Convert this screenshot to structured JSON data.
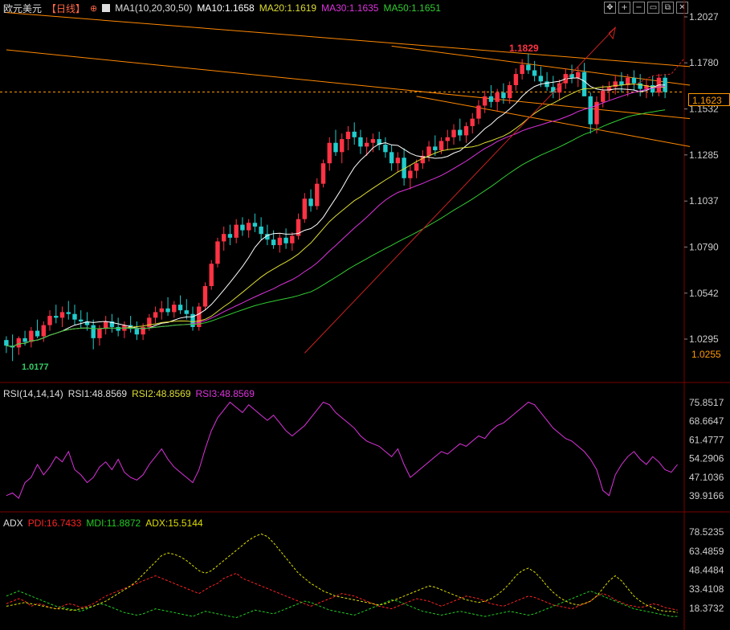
{
  "header": {
    "symbol": "欧元美元",
    "period": "【日线】",
    "ma_group": "MA1(10,20,30,50)",
    "ma10": "MA10:1.1658",
    "ma20": "MA20:1.1619",
    "ma30": "MA30:1.1635",
    "ma50": "MA50:1.1651"
  },
  "toolbar_icons": [
    "move-icon",
    "zoom-in-icon",
    "zoom-out-icon",
    "window-icon",
    "restore-icon",
    "close-icon"
  ],
  "toolbar_glyphs": [
    "✥",
    "+",
    "−",
    "▭",
    "⧉",
    "✕"
  ],
  "price_axis": {
    "ticks": [
      "1.2027",
      "1.1780",
      "1.1532",
      "1.1285",
      "1.1037",
      "1.0790",
      "1.0542",
      "1.0295"
    ],
    "current_price": "1.1623",
    "low_price_tag": "1.0255"
  },
  "annotations": {
    "high": "1.1829",
    "low": "1.0177"
  },
  "rsi_panel": {
    "title": "RSI(14,14,14)",
    "rsi1": "RSI1:48.8569",
    "rsi2": "RSI2:48.8569",
    "rsi3": "RSI3:48.8569",
    "ticks": [
      "75.8517",
      "68.6647",
      "61.4777",
      "54.2906",
      "47.1036",
      "39.9166"
    ]
  },
  "adx_panel": {
    "title": "ADX",
    "pdi": "PDI:16.7433",
    "mdi": "MDI:11.8872",
    "adx": "ADX:15.5144",
    "ticks": [
      "78.5235",
      "63.4859",
      "48.4484",
      "33.4108",
      "18.3732"
    ]
  },
  "colors": {
    "up": "#ff3344",
    "down": "#22cccc",
    "ma10": "#ffffff",
    "ma20": "#dddd33",
    "ma30": "#dd33dd",
    "ma50": "#33cc33",
    "channel": "#ff8800",
    "rsi": "#dd33dd",
    "pdi": "#ff2222",
    "mdi": "#22cc22",
    "adx": "#dddd00",
    "axis_text": "#cccccc"
  },
  "chart_data": [
    {
      "type": "candlestick",
      "title": "欧元美元【日线】",
      "ylim": [
        1.0177,
        1.2027
      ],
      "high": 1.1829,
      "low": 1.0177,
      "last": 1.1623,
      "series": [
        {
          "name": "MA10",
          "last": 1.1658
        },
        {
          "name": "MA20",
          "last": 1.1619
        },
        {
          "name": "MA30",
          "last": 1.1635
        },
        {
          "name": "MA50",
          "last": 1.1651
        }
      ],
      "candles": [
        [
          1.029,
          1.031,
          1.022,
          1.026
        ],
        [
          1.026,
          1.032,
          1.0177,
          1.025
        ],
        [
          1.025,
          1.031,
          1.021,
          1.03
        ],
        [
          1.03,
          1.034,
          1.026,
          1.028
        ],
        [
          1.028,
          1.036,
          1.025,
          1.034
        ],
        [
          1.034,
          1.04,
          1.03,
          1.031
        ],
        [
          1.031,
          1.039,
          1.028,
          1.037
        ],
        [
          1.037,
          1.045,
          1.034,
          1.042
        ],
        [
          1.042,
          1.048,
          1.038,
          1.041
        ],
        [
          1.041,
          1.047,
          1.036,
          1.044
        ],
        [
          1.044,
          1.05,
          1.04,
          1.043
        ],
        [
          1.043,
          1.048,
          1.037,
          1.04
        ],
        [
          1.04,
          1.045,
          1.035,
          1.039
        ],
        [
          1.039,
          1.044,
          1.034,
          1.037
        ],
        [
          1.037,
          1.04,
          1.024,
          1.03
        ],
        [
          1.03,
          1.037,
          1.026,
          1.035
        ],
        [
          1.035,
          1.042,
          1.032,
          1.039
        ],
        [
          1.039,
          1.043,
          1.033,
          1.036
        ],
        [
          1.036,
          1.041,
          1.031,
          1.034
        ],
        [
          1.034,
          1.039,
          1.03,
          1.037
        ],
        [
          1.037,
          1.042,
          1.033,
          1.035
        ],
        [
          1.035,
          1.039,
          1.029,
          1.032
        ],
        [
          1.032,
          1.038,
          1.029,
          1.036
        ],
        [
          1.036,
          1.043,
          1.034,
          1.041
        ],
        [
          1.041,
          1.047,
          1.038,
          1.044
        ],
        [
          1.044,
          1.05,
          1.04,
          1.046
        ],
        [
          1.046,
          1.052,
          1.042,
          1.044
        ],
        [
          1.044,
          1.05,
          1.041,
          1.048
        ],
        [
          1.048,
          1.053,
          1.043,
          1.045
        ],
        [
          1.045,
          1.051,
          1.04,
          1.043
        ],
        [
          1.043,
          1.047,
          1.034,
          1.036
        ],
        [
          1.036,
          1.049,
          1.034,
          1.047
        ],
        [
          1.047,
          1.06,
          1.045,
          1.058
        ],
        [
          1.058,
          1.072,
          1.056,
          1.07
        ],
        [
          1.07,
          1.084,
          1.068,
          1.082
        ],
        [
          1.082,
          1.09,
          1.077,
          1.086
        ],
        [
          1.086,
          1.091,
          1.08,
          1.084
        ],
        [
          1.084,
          1.094,
          1.081,
          1.091
        ],
        [
          1.091,
          1.095,
          1.085,
          1.088
        ],
        [
          1.088,
          1.094,
          1.084,
          1.092
        ],
        [
          1.092,
          1.097,
          1.087,
          1.09
        ],
        [
          1.09,
          1.095,
          1.083,
          1.086
        ],
        [
          1.086,
          1.091,
          1.08,
          1.083
        ],
        [
          1.083,
          1.088,
          1.078,
          1.08
        ],
        [
          1.08,
          1.086,
          1.076,
          1.084
        ],
        [
          1.084,
          1.089,
          1.078,
          1.081
        ],
        [
          1.081,
          1.087,
          1.077,
          1.085
        ],
        [
          1.085,
          1.097,
          1.083,
          1.094
        ],
        [
          1.094,
          1.108,
          1.092,
          1.105
        ],
        [
          1.105,
          1.11,
          1.098,
          1.101
        ],
        [
          1.101,
          1.116,
          1.099,
          1.113
        ],
        [
          1.113,
          1.126,
          1.111,
          1.124
        ],
        [
          1.124,
          1.138,
          1.12,
          1.135
        ],
        [
          1.135,
          1.142,
          1.128,
          1.13
        ],
        [
          1.13,
          1.14,
          1.124,
          1.137
        ],
        [
          1.137,
          1.144,
          1.131,
          1.141
        ],
        [
          1.141,
          1.146,
          1.134,
          1.138
        ],
        [
          1.138,
          1.142,
          1.129,
          1.133
        ],
        [
          1.133,
          1.138,
          1.128,
          1.135
        ],
        [
          1.135,
          1.14,
          1.13,
          1.137
        ],
        [
          1.137,
          1.141,
          1.131,
          1.134
        ],
        [
          1.134,
          1.138,
          1.127,
          1.13
        ],
        [
          1.13,
          1.134,
          1.12,
          1.124
        ],
        [
          1.124,
          1.13,
          1.119,
          1.127
        ],
        [
          1.127,
          1.132,
          1.112,
          1.116
        ],
        [
          1.116,
          1.123,
          1.11,
          1.12
        ],
        [
          1.12,
          1.126,
          1.116,
          1.124
        ],
        [
          1.124,
          1.131,
          1.121,
          1.128
        ],
        [
          1.128,
          1.136,
          1.125,
          1.133
        ],
        [
          1.133,
          1.139,
          1.128,
          1.131
        ],
        [
          1.131,
          1.138,
          1.129,
          1.136
        ],
        [
          1.136,
          1.142,
          1.131,
          1.138
        ],
        [
          1.138,
          1.145,
          1.134,
          1.142
        ],
        [
          1.142,
          1.148,
          1.136,
          1.139
        ],
        [
          1.139,
          1.146,
          1.135,
          1.144
        ],
        [
          1.144,
          1.151,
          1.14,
          1.148
        ],
        [
          1.148,
          1.158,
          1.145,
          1.155
        ],
        [
          1.155,
          1.163,
          1.151,
          1.16
        ],
        [
          1.16,
          1.166,
          1.154,
          1.157
        ],
        [
          1.157,
          1.164,
          1.152,
          1.162
        ],
        [
          1.162,
          1.167,
          1.156,
          1.159
        ],
        [
          1.159,
          1.168,
          1.156,
          1.166
        ],
        [
          1.166,
          1.175,
          1.163,
          1.172
        ],
        [
          1.172,
          1.18,
          1.169,
          1.177
        ],
        [
          1.177,
          1.1829,
          1.172,
          1.174
        ],
        [
          1.174,
          1.179,
          1.168,
          1.171
        ],
        [
          1.171,
          1.176,
          1.165,
          1.168
        ],
        [
          1.168,
          1.173,
          1.163,
          1.165
        ],
        [
          1.165,
          1.171,
          1.159,
          1.162
        ],
        [
          1.162,
          1.169,
          1.158,
          1.167
        ],
        [
          1.167,
          1.175,
          1.164,
          1.172
        ],
        [
          1.172,
          1.177,
          1.167,
          1.17
        ],
        [
          1.17,
          1.176,
          1.165,
          1.173
        ],
        [
          1.173,
          1.178,
          1.164,
          1.16
        ],
        [
          1.16,
          1.162,
          1.14,
          1.145
        ],
        [
          1.145,
          1.16,
          1.14,
          1.157
        ],
        [
          1.157,
          1.166,
          1.154,
          1.163
        ],
        [
          1.163,
          1.168,
          1.158,
          1.165
        ],
        [
          1.165,
          1.171,
          1.161,
          1.168
        ],
        [
          1.168,
          1.173,
          1.162,
          1.166
        ],
        [
          1.166,
          1.172,
          1.16,
          1.17
        ],
        [
          1.17,
          1.174,
          1.163,
          1.167
        ],
        [
          1.167,
          1.172,
          1.16,
          1.164
        ],
        [
          1.164,
          1.169,
          1.159,
          1.166
        ],
        [
          1.166,
          1.171,
          1.16,
          1.162
        ],
        [
          1.162,
          1.172,
          1.16,
          1.17
        ],
        [
          1.17,
          1.172,
          1.159,
          1.1623
        ]
      ]
    },
    {
      "type": "line",
      "title": "RSI(14,14,14)",
      "ylim": [
        38,
        78
      ],
      "series": [
        {
          "name": "RSI1",
          "last": 48.8569
        },
        {
          "name": "RSI2",
          "last": 48.8569
        },
        {
          "name": "RSI3",
          "last": 48.8569
        }
      ],
      "values": [
        40,
        41,
        39,
        45,
        47,
        52,
        48,
        51,
        55,
        53,
        57,
        50,
        48,
        45,
        47,
        51,
        53,
        50,
        54,
        49,
        47,
        46,
        48,
        52,
        55,
        58,
        54,
        51,
        49,
        47,
        45,
        50,
        58,
        65,
        70,
        73,
        76,
        74,
        72,
        75,
        73,
        71,
        69,
        71,
        68,
        65,
        63,
        65,
        67,
        70,
        73,
        76,
        75,
        72,
        70,
        68,
        66,
        63,
        61,
        60,
        59,
        57,
        55,
        58,
        52,
        47,
        49,
        51,
        53,
        55,
        57,
        56,
        58,
        60,
        59,
        61,
        63,
        62,
        65,
        67,
        68,
        70,
        72,
        74,
        76,
        75,
        72,
        69,
        66,
        64,
        62,
        61,
        59,
        57,
        54,
        50,
        42,
        40,
        48,
        52,
        55,
        57,
        54,
        52,
        55,
        53,
        50,
        49,
        52
      ]
    },
    {
      "type": "line",
      "title": "ADX",
      "ylim": [
        12,
        82
      ],
      "series": [
        {
          "name": "PDI",
          "last": 16.7433,
          "values": [
            22,
            24,
            26,
            24,
            20,
            22,
            21,
            19,
            18,
            20,
            22,
            21,
            19,
            20,
            22,
            25,
            28,
            30,
            32,
            34,
            36,
            38,
            40,
            42,
            44,
            42,
            40,
            38,
            36,
            34,
            32,
            30,
            33,
            36,
            38,
            42,
            44,
            46,
            42,
            40,
            38,
            36,
            34,
            32,
            30,
            28,
            26,
            24,
            22,
            20,
            22,
            24,
            26,
            28,
            30,
            29,
            28,
            26,
            24,
            22,
            20,
            19,
            18,
            20,
            22,
            24,
            26,
            25,
            24,
            22,
            20,
            22,
            24,
            26,
            28,
            27,
            26,
            24,
            22,
            21,
            20,
            22,
            24,
            26,
            28,
            27,
            25,
            23,
            21,
            20,
            19,
            18,
            20,
            22,
            24,
            28,
            30,
            28,
            25,
            23,
            21,
            20,
            19,
            20,
            22,
            21,
            19,
            18,
            17
          ]
        },
        {
          "name": "MDI",
          "last": 11.8872,
          "values": [
            28,
            30,
            32,
            30,
            28,
            26,
            24,
            22,
            20,
            19,
            18,
            17,
            16,
            18,
            20,
            22,
            21,
            19,
            17,
            15,
            14,
            13,
            14,
            16,
            18,
            17,
            16,
            15,
            14,
            13,
            12,
            14,
            16,
            15,
            14,
            13,
            12,
            11,
            13,
            15,
            17,
            16,
            15,
            14,
            16,
            18,
            20,
            22,
            24,
            23,
            21,
            19,
            17,
            16,
            15,
            14,
            13,
            15,
            17,
            19,
            21,
            23,
            25,
            24,
            22,
            20,
            18,
            16,
            15,
            14,
            13,
            14,
            15,
            16,
            15,
            14,
            13,
            12,
            13,
            14,
            15,
            16,
            15,
            14,
            13,
            14,
            16,
            18,
            20,
            22,
            24,
            26,
            28,
            30,
            32,
            30,
            28,
            26,
            24,
            22,
            20,
            18,
            17,
            16,
            15,
            14,
            13,
            12,
            12
          ]
        },
        {
          "name": "ADX",
          "last": 15.5144,
          "values": [
            20,
            21,
            22,
            23,
            22,
            21,
            20,
            19,
            18,
            18,
            17,
            17,
            18,
            19,
            20,
            22,
            24,
            27,
            30,
            33,
            36,
            40,
            45,
            50,
            55,
            60,
            62,
            61,
            59,
            56,
            52,
            48,
            46,
            48,
            52,
            56,
            60,
            64,
            68,
            72,
            75,
            77,
            75,
            70,
            64,
            58,
            52,
            46,
            42,
            38,
            35,
            32,
            30,
            28,
            27,
            26,
            25,
            24,
            23,
            22,
            21,
            22,
            24,
            26,
            28,
            30,
            32,
            34,
            36,
            35,
            33,
            31,
            29,
            27,
            25,
            24,
            23,
            24,
            26,
            29,
            33,
            38,
            44,
            48,
            50,
            47,
            42,
            36,
            31,
            27,
            24,
            22,
            21,
            22,
            24,
            28,
            34,
            40,
            44,
            40,
            34,
            28,
            24,
            21,
            19,
            17,
            16,
            16,
            15
          ]
        }
      ]
    }
  ]
}
